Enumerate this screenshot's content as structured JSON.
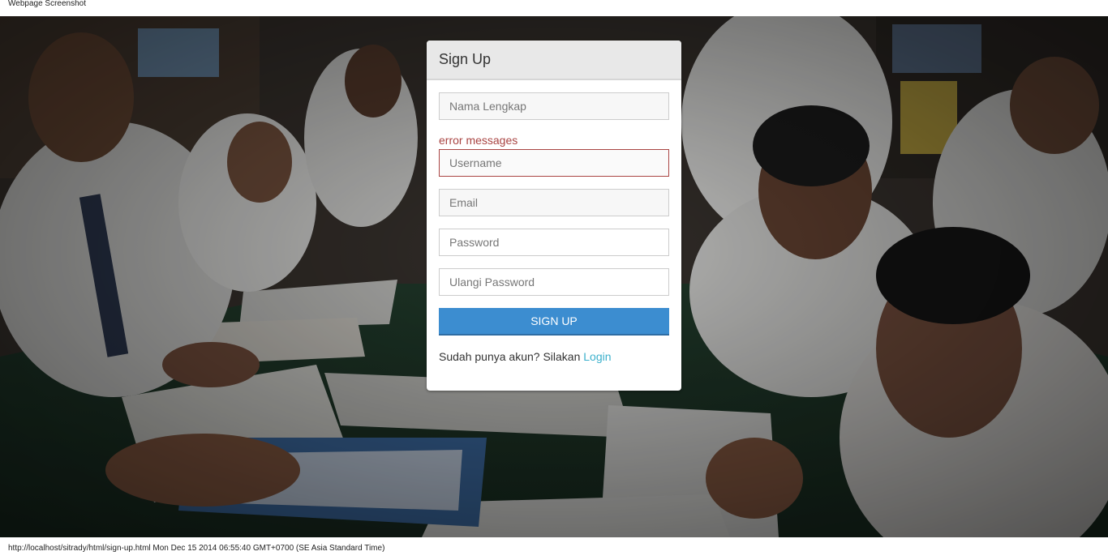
{
  "capture": {
    "header_text": "Webpage Screenshot",
    "footer_text": "http://localhost/sitrady/html/sign-up.html Mon Dec 15 2014 06:55:40 GMT+0700 (SE Asia Standard Time)"
  },
  "signup": {
    "title": "Sign Up",
    "fullname_placeholder": "Nama Lengkap",
    "error_message": "error messages",
    "username_placeholder": "Username",
    "email_placeholder": "Email",
    "password_placeholder": "Password",
    "confirm_password_placeholder": "Ulangi Password",
    "submit_label": "SIGN UP",
    "login_prompt": "Sudah punya akun? Silakan",
    "login_link": "Login"
  },
  "colors": {
    "accent": "#3c8dd0",
    "error": "#a94442",
    "link": "#3bb0cc",
    "panel_heading_bg": "#e8e8e8"
  }
}
